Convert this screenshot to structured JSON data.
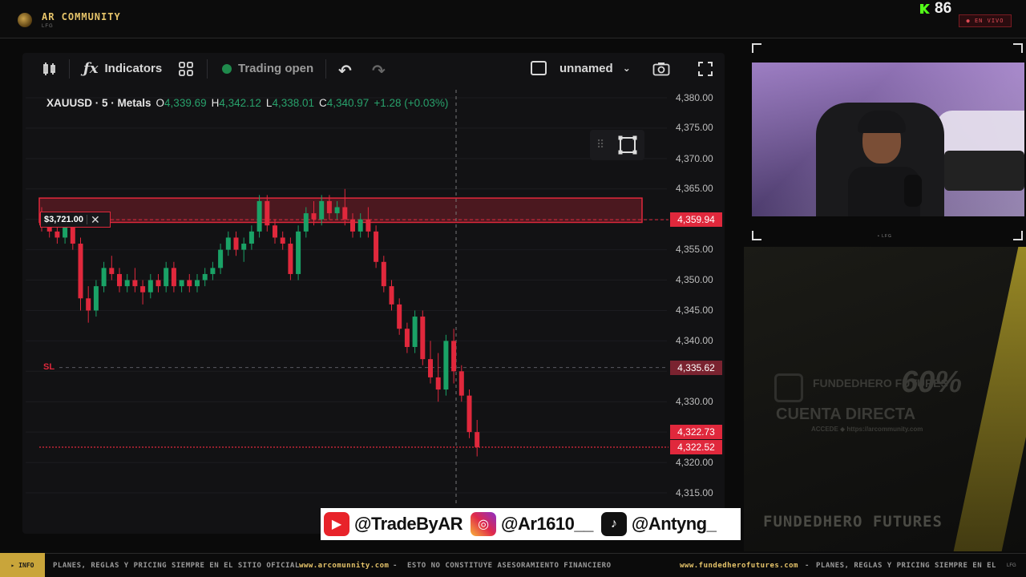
{
  "header": {
    "brand_name": "AR COMMUNITY",
    "brand_sub": "LFG",
    "viewer_count": "86",
    "live_badge": "● EN VIVO"
  },
  "toolbar": {
    "indicators_label": "Indicators",
    "trading_status": "Trading open",
    "layout_name": "unnamed"
  },
  "legend": {
    "symbol": "XAUUSD · 5 · Metals",
    "open_key": "O",
    "open_val": "4,339.69",
    "high_key": "H",
    "high_val": "4,342.12",
    "low_key": "L",
    "low_val": "4,338.01",
    "close_key": "C",
    "close_val": "4,340.97",
    "change": "+1.28 (+0.03%)"
  },
  "price_axis": {
    "ticks": [
      "4,380.00",
      "4,375.00",
      "4,370.00",
      "4,365.00",
      "4,355.00",
      "4,350.00",
      "4,345.00",
      "4,340.00",
      "4,330.00",
      "4,320.00",
      "4,315.00"
    ],
    "tag_zone": "4,359.94",
    "tag_sl": "4,335.62",
    "tag_last_1": "4,322.73",
    "tag_last_2": "4,322.52"
  },
  "overlays": {
    "alert_value": "$3,721.00",
    "alert_close": "✕",
    "sl_label": "SL"
  },
  "chart_data": {
    "type": "candlestick",
    "symbol": "XAUUSD",
    "interval": "5",
    "ylim": [
      4313,
      4382
    ],
    "zone": [
      4359.5,
      4363.5
    ],
    "sl_level": 4335.62,
    "last_price": 4322.52,
    "candles": [
      [
        4361,
        4362,
        4358,
        4359
      ],
      [
        4359,
        4360,
        4357,
        4358
      ],
      [
        4358,
        4359,
        4356,
        4357
      ],
      [
        4357,
        4360,
        4356,
        4359
      ],
      [
        4359,
        4360,
        4355,
        4356
      ],
      [
        4356,
        4357,
        4345,
        4347
      ],
      [
        4347,
        4349,
        4343,
        4345
      ],
      [
        4345,
        4350,
        4344,
        4349
      ],
      [
        4349,
        4353,
        4348,
        4352
      ],
      [
        4352,
        4354,
        4350,
        4351
      ],
      [
        4351,
        4352,
        4348,
        4349
      ],
      [
        4349,
        4351,
        4348,
        4350
      ],
      [
        4350,
        4352,
        4348,
        4349
      ],
      [
        4349,
        4350,
        4346,
        4348
      ],
      [
        4348,
        4351,
        4347,
        4350
      ],
      [
        4350,
        4351,
        4348,
        4349
      ],
      [
        4349,
        4353,
        4348,
        4352
      ],
      [
        4352,
        4353,
        4348,
        4349
      ],
      [
        4349,
        4350,
        4348,
        4350
      ],
      [
        4350,
        4351,
        4348,
        4349
      ],
      [
        4349,
        4351,
        4348,
        4350
      ],
      [
        4350,
        4352,
        4349,
        4351
      ],
      [
        4351,
        4353,
        4350,
        4352
      ],
      [
        4352,
        4356,
        4351,
        4355
      ],
      [
        4355,
        4358,
        4354,
        4357
      ],
      [
        4357,
        4358,
        4354,
        4355
      ],
      [
        4355,
        4357,
        4353,
        4356
      ],
      [
        4356,
        4359,
        4355,
        4358
      ],
      [
        4358,
        4364,
        4357,
        4363
      ],
      [
        4363,
        4364,
        4358,
        4359
      ],
      [
        4359,
        4360,
        4356,
        4357
      ],
      [
        4357,
        4358,
        4355,
        4356
      ],
      [
        4356,
        4357,
        4350,
        4351
      ],
      [
        4351,
        4359,
        4350,
        4358
      ],
      [
        4358,
        4362,
        4357,
        4361
      ],
      [
        4361,
        4363,
        4359,
        4360
      ],
      [
        4360,
        4364,
        4359,
        4363
      ],
      [
        4363,
        4364,
        4360,
        4361
      ],
      [
        4361,
        4363,
        4360,
        4362
      ],
      [
        4362,
        4365,
        4359,
        4360
      ],
      [
        4360,
        4361,
        4357,
        4358
      ],
      [
        4358,
        4361,
        4357,
        4360
      ],
      [
        4360,
        4362,
        4357,
        4358
      ],
      [
        4358,
        4359,
        4352,
        4353
      ],
      [
        4353,
        4354,
        4348,
        4349
      ],
      [
        4349,
        4350,
        4345,
        4346
      ],
      [
        4346,
        4347,
        4341,
        4342
      ],
      [
        4342,
        4343,
        4338,
        4339
      ],
      [
        4339,
        4345,
        4338,
        4344
      ],
      [
        4344,
        4345,
        4336,
        4337
      ],
      [
        4337,
        4340,
        4333,
        4334
      ],
      [
        4334,
        4338,
        4330,
        4332
      ],
      [
        4332,
        4341,
        4331,
        4340
      ],
      [
        4340,
        4342,
        4333,
        4335
      ],
      [
        4335,
        4336,
        4330,
        4331
      ],
      [
        4331,
        4332,
        4324,
        4325
      ],
      [
        4325,
        4327,
        4321,
        4322.52
      ]
    ]
  },
  "webcam": {
    "caption": "• LFG"
  },
  "ad": {
    "title": "FUNDEDHERO FUTURES",
    "faint_brand": "FUNDEDHERO FUTURES",
    "faint_pct": "60%",
    "faint_line": "CUENTA DIRECTA",
    "faint_small": "ACCEDE ◆ https://arcommunity.com"
  },
  "social": {
    "youtube": "@TradeByAR",
    "instagram": "@Ar1610__",
    "tiktok": "@Antyng_"
  },
  "ticker": {
    "info": "▸ INFO",
    "seg1": "PLANES, REGLAS Y PRICING SIEMPRE EN EL SITIO OFICIAL",
    "seg2": "www.arcomunnity.com",
    "seg3": "ESTO NO CONSTITUYE ASESORAMIENTO FINANCIERO",
    "seg4": "www.fundedherofutures.com",
    "seg5": "PLANES, REGLAS Y PRICING SIEMPRE EN EL SIT",
    "lfg": "LFG"
  },
  "colors": {
    "bull": "#1aa266",
    "bear": "#e0283c",
    "accent_gold": "#e6c46a"
  }
}
